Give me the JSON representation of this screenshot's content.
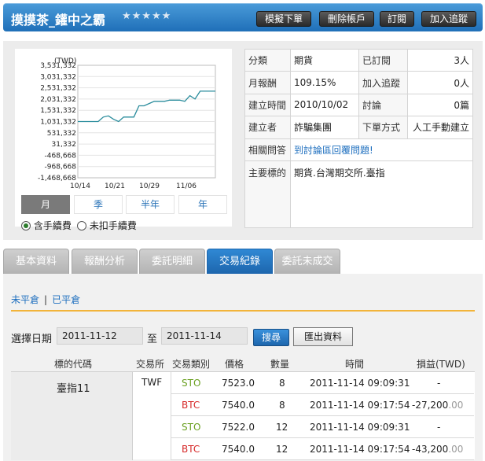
{
  "header": {
    "title": "摸摸茶_鑵中之霸",
    "stars": "★★★★★",
    "buttons": [
      "模擬下單",
      "刪除帳戶",
      "訂閱",
      "加入追蹤"
    ]
  },
  "chart": {
    "unit_label": "(TWD)",
    "y_ticks": [
      "3,531,332",
      "3,031,332",
      "2,531,332",
      "2,031,332",
      "1,531,332",
      "1,031,332",
      "531,332",
      "31,332",
      "-468,668",
      "-968,668",
      "-1,468,668"
    ],
    "x_ticks": [
      "10/14",
      "10/21",
      "10/29",
      "11/06"
    ],
    "periods": [
      "月",
      "季",
      "半年",
      "年"
    ],
    "active_period": "月",
    "fee_options": [
      "含手續費",
      "未扣手續費"
    ],
    "fee_selected": "含手續費"
  },
  "chart_data": {
    "type": "line",
    "ylabel": "(TWD)",
    "ylim": [
      -1468668,
      3531332
    ],
    "x_tick_labels": [
      "10/14",
      "10/21",
      "10/29",
      "11/06"
    ],
    "grid": true,
    "series": [
      {
        "values": [
          1031332,
          1031332,
          1031332,
          1031332,
          1031332,
          1231332,
          1281332,
          1131332,
          1031332,
          1231332,
          1231332,
          1231332,
          1731332,
          1731332,
          1831332,
          1931332,
          1931332,
          1931332,
          1981332,
          1981332,
          1981332,
          1931332,
          2181332,
          2031332,
          2381332,
          2381332,
          2381332,
          2381332
        ]
      }
    ]
  },
  "info": {
    "rows": [
      {
        "k1": "分類",
        "v1": "期貨",
        "k2": "已訂閱",
        "v2": "3人"
      },
      {
        "k1": "月報酬",
        "v1": "109.15%",
        "k2": "加入追蹤",
        "v2": "0人"
      },
      {
        "k1": "建立時間",
        "v1": "2010/10/02",
        "k2": "討論",
        "v2": "0篇"
      },
      {
        "k1": "建立者",
        "v1": "詐騙集團",
        "k2": "下單方式",
        "v2": "人工手動建立"
      }
    ],
    "related_label": "相關問答",
    "related_link": "到討論區回覆問題!",
    "target_label": "主要標的",
    "target_value": "期貨.台灣期交所.臺指"
  },
  "tabs": [
    "基本資料",
    "報酬分析",
    "委託明細",
    "交易紀錄",
    "委託未成交"
  ],
  "active_tab": "交易紀錄",
  "subtabs": [
    "未平倉",
    "已平倉"
  ],
  "date_filter": {
    "label": "選擇日期",
    "from": "2011-11-12",
    "to_label": "至",
    "to": "2011-11-14",
    "search": "搜尋",
    "export": "匯出資料"
  },
  "table": {
    "headers": [
      "標的代碼",
      "交易所",
      "交易類別",
      "價格",
      "數量",
      "時間",
      "損益(TWD)"
    ],
    "symbol": "臺指11",
    "exchange": "TWF",
    "rows": [
      {
        "type": "STO",
        "price": "7523.0",
        "qty": "8",
        "time": "2011-11-14 09:09:31",
        "pnl": "-",
        "pnl_dec": ""
      },
      {
        "type": "BTC",
        "price": "7540.0",
        "qty": "8",
        "time": "2011-11-14 09:17:54",
        "pnl": "-27,200",
        "pnl_dec": ".00"
      },
      {
        "type": "STO",
        "price": "7522.0",
        "qty": "12",
        "time": "2011-11-14 09:09:31",
        "pnl": "-",
        "pnl_dec": ""
      },
      {
        "type": "BTC",
        "price": "7540.0",
        "qty": "12",
        "time": "2011-11-14 09:17:54",
        "pnl": "-43,200",
        "pnl_dec": ".00"
      }
    ]
  }
}
